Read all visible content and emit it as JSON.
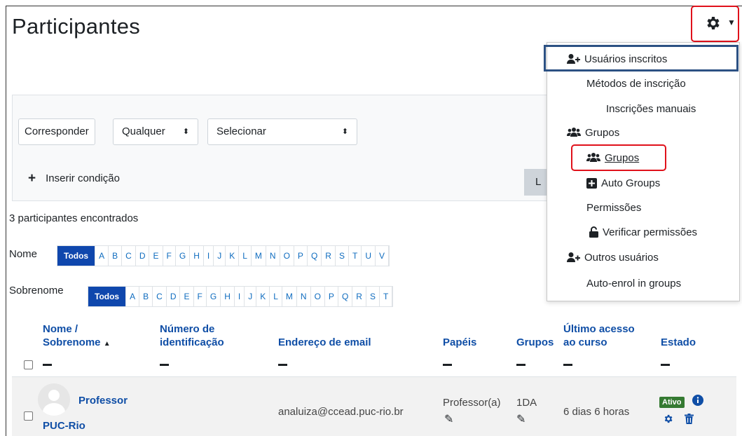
{
  "page": {
    "title": "Participantes"
  },
  "filter": {
    "match_label": "Corresponder",
    "match_value": "Qualquer",
    "select_placeholder": "Selecionar",
    "add_condition": "Inserir condição",
    "apply_button_partial": "L"
  },
  "results": {
    "count_text": "3 participantes encontrados"
  },
  "initials": {
    "first_label": "Nome",
    "last_label": "Sobrenome",
    "all": "Todos",
    "first_letters": [
      "A",
      "B",
      "C",
      "D",
      "E",
      "F",
      "G",
      "H",
      "I",
      "J",
      "K",
      "L",
      "M",
      "N",
      "O",
      "P",
      "Q",
      "R",
      "S",
      "T",
      "U",
      "V"
    ],
    "last_letters": [
      "A",
      "B",
      "C",
      "D",
      "E",
      "F",
      "G",
      "H",
      "I",
      "J",
      "K",
      "L",
      "M",
      "N",
      "O",
      "P",
      "Q",
      "R",
      "S",
      "T"
    ]
  },
  "table": {
    "headers": {
      "name_line1": "Nome /",
      "name_line2": "Sobrenome",
      "idnum_line1": "Número de",
      "idnum_line2": "identificação",
      "email": "Endereço de email",
      "roles": "Papéis",
      "groups": "Grupos",
      "lastaccess_line1": "Último acesso",
      "lastaccess_line2": "ao curso",
      "status": "Estado"
    },
    "rows": [
      {
        "first_name": "Professor",
        "last_name": "PUC-Rio",
        "email": "analuiza@ccead.puc-rio.br",
        "role": "Professor(a)",
        "group": "1DA",
        "last_access": "6 dias 6 horas",
        "status": "Ativo"
      }
    ]
  },
  "menu": {
    "items": [
      "Usuários inscritos",
      "Métodos de inscrição",
      "Inscrições manuais",
      "Grupos",
      "Grupos",
      "Auto Groups",
      "Permissões",
      "Verificar permissões",
      "Outros usuários",
      "Auto-enrol in groups"
    ]
  },
  "colors": {
    "link": "#0f4ea6",
    "active_badge": "#357a32",
    "highlight_red": "#e0111b",
    "highlight_blue": "#2c5183"
  }
}
